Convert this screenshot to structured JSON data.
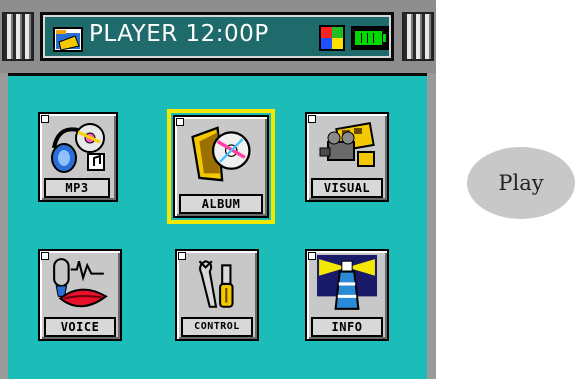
{
  "header": {
    "title": "PLAYER 12:00P",
    "folder_icon": "folder-icon",
    "windows_icon": "windows-logo-icon",
    "battery_icon": "battery-icon"
  },
  "menu": {
    "selected": "ALBUM",
    "items": [
      {
        "label": "MP3",
        "icon": "headphones-cd-icon"
      },
      {
        "label": "ALBUM",
        "icon": "album-cd-icon"
      },
      {
        "label": "VISUAL",
        "icon": "film-projector-icon"
      },
      {
        "label": "VOICE",
        "icon": "microphone-lips-icon"
      },
      {
        "label": "CONTROL",
        "icon": "tools-icon"
      },
      {
        "label": "INFO",
        "icon": "lighthouse-icon"
      }
    ]
  },
  "play_button": {
    "label": "Play"
  },
  "colors": {
    "screen": "#1cbcb8",
    "title_bar": "#1f6b6b",
    "selection": "#f4e800",
    "frame": "#9a9a9a"
  }
}
